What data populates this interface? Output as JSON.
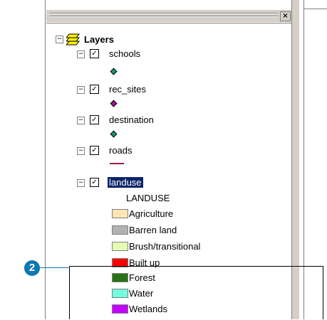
{
  "window": {
    "close_glyph": "×"
  },
  "toc": {
    "root": {
      "expander": "−",
      "label": "Layers"
    },
    "layers": [
      {
        "name": "schools",
        "checked": "✓",
        "expander": "−",
        "symbol_color": "#1a9a7a"
      },
      {
        "name": "rec_sites",
        "checked": "✓",
        "expander": "−",
        "symbol_color": "#a0148c"
      },
      {
        "name": "destination",
        "checked": "✓",
        "expander": "−",
        "symbol_color": "#1a9a7a"
      },
      {
        "name": "roads",
        "checked": "✓",
        "expander": "−",
        "symbol_color": "#a01850"
      },
      {
        "name": "landuse",
        "checked": "✓",
        "expander": "−"
      }
    ],
    "landuse_field": "LANDUSE",
    "legend": [
      {
        "label": "Agriculture",
        "color": "#ffe6b4"
      },
      {
        "label": "Barren land",
        "color": "#b2b2b2"
      },
      {
        "label": "Brush/transitional",
        "color": "#e6fab4"
      },
      {
        "label": "Built up",
        "color": "#ff0000"
      },
      {
        "label": "Forest",
        "color": "#287314"
      },
      {
        "label": "Water",
        "color": "#73ffdf"
      },
      {
        "label": "Wetlands",
        "color": "#c500ff"
      }
    ]
  },
  "callout": {
    "number": "2"
  }
}
